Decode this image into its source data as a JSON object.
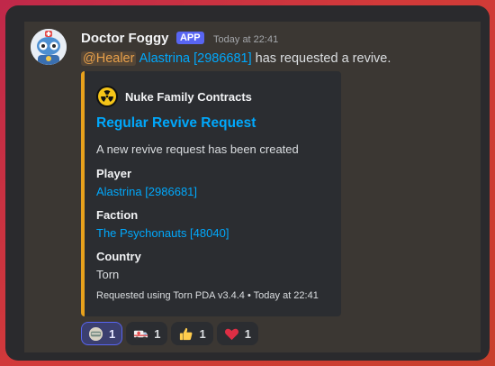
{
  "message": {
    "username": "Doctor Foggy",
    "badge": "APP",
    "timestamp": "Today at 22:41",
    "mention_role": "@Healer",
    "mention_user": "Alastrina [2986681]",
    "text_suffix": "has requested a revive."
  },
  "embed": {
    "accent_color": "#e8a11c",
    "author_icon": "radiation-icon",
    "author": "Nuke Family Contracts",
    "title": "Regular Revive Request",
    "description": "A new revive request has been created",
    "fields": [
      {
        "name": "Player",
        "value": "Alastrina [2986681]"
      },
      {
        "name": "Faction",
        "value": "The Psychonauts [48040]"
      },
      {
        "name": "Country",
        "value": "Torn"
      }
    ],
    "footer": "Requested using Torn PDA v3.4.4 • Today at 22:41"
  },
  "reactions": [
    {
      "icon": "custom-emoji-icon",
      "count": "1"
    },
    {
      "icon": "ambulance-icon",
      "count": "1"
    },
    {
      "icon": "thumbs-up-icon",
      "count": "1"
    },
    {
      "icon": "heart-icon",
      "count": "1"
    }
  ]
}
